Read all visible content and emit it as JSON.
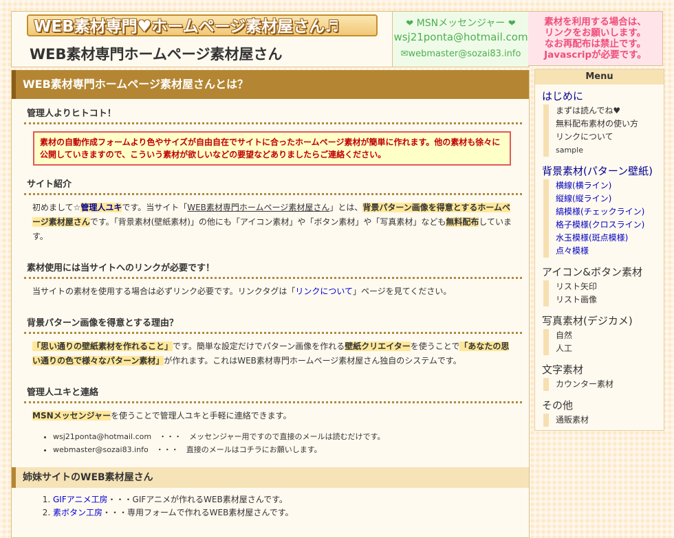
{
  "header": {
    "logo_text": "WEB素材専門♥ホームページ素材屋さん♬",
    "subtitle": "WEB素材専門ホームページ素材屋さん",
    "msn_title": "MSNメッセンジャー",
    "msn_email": "wsj21ponta@hotmail.com",
    "webmaster_email": "✉webmaster@sozai83.info"
  },
  "notice_box": {
    "lines": [
      "素材を利用する場合は、",
      "リンクをお願いします。",
      "なお再配布は禁止です。",
      "Javascripが必要です。"
    ]
  },
  "main": {
    "title": "WEB素材専門ホームページ素材屋さんとは？",
    "sections": {
      "hitokoto_title": "管理人よりヒトコト！",
      "hitokoto_text": "素材の自動作成フォームより色やサイズが自由自在でサイトに合ったホームページ素材が簡単に作れます。他の素材も徐々に公開していきますので、こういう素材が欲しいなどの要望などありましたらご連絡ください。",
      "intro_title": "サイト紹介",
      "intro_p1": "初めまして☆",
      "intro_name": "管理人ユキ",
      "intro_p2": "です。当サイト「",
      "intro_site": "WEB素材専門ホームページ素材屋さん",
      "intro_p3": "」とは、",
      "intro_hl1": "背景パターン画像を得意とするホームページ素材屋さん",
      "intro_p4": "です。「背景素材(壁紙素材)」の他にも「アイコン素材」や「ボタン素材」や「写真素材」なども",
      "intro_hl2": "無料配布",
      "intro_p5": "しています。",
      "link_title": "素材使用には当サイトへのリンクが必要です！",
      "link_p1": "当サイトの素材を使用する場合は必ずリンク必要です。リンクタグは「",
      "link_anchor": "リンクについて",
      "link_p2": "」ページを見てください。",
      "reason_title": "背景パターン画像を得意とする理由？",
      "reason_hl1": "「思い通りの壁紙素材を作れること」",
      "reason_p1": "です。簡単な設定だけでパターン画像を作れる",
      "reason_hl2": "壁紙クリエイター",
      "reason_p2": "を使うことで",
      "reason_hl3": "「あなたの思い通りの色で様々なパターン素材」",
      "reason_p3": "が作れます。これはWEB素材専門ホームページ素材屋さん独自のシステムです。",
      "contact_title": "管理人ユキと連絡",
      "contact_hl": "MSNメッセンジャー",
      "contact_p": "を使うことで管理人ユキと手軽に連絡できます。",
      "contacts": [
        {
          "email": "wsj21ponta@hotmail.com",
          "note": "・・・　メッセンジャー用ですので直接のメールは読むだけです。"
        },
        {
          "email": "webmaster@sozai83.info",
          "note": "・・・　直接のメールはコチラにお願いします。"
        }
      ]
    },
    "sister_title": "姉妹サイトのWEB素材屋さん",
    "sisters": [
      {
        "name": "GIFアニメ工房",
        "desc": "・・・GIFアニメが作れるWEB素材屋さんです。"
      },
      {
        "name": "素ボタン工房",
        "desc": "・・・専用フォームで作れるWEB素材屋さんです。"
      }
    ]
  },
  "sidebar": {
    "menu_title": "Menu",
    "categories": [
      {
        "label": "はじめに",
        "items": [
          "まずは読んでね♥",
          "無料配布素材の使い方",
          "リンクについて",
          "sample"
        ]
      },
      {
        "label": "背景素材(パターン壁紙)",
        "items": [
          "横線(横ライン)",
          "縦線(縦ライン)",
          "縞模様(チェックライン)",
          "格子模様(クロスライン)",
          "水玉模様(斑点模様)",
          "点々模様"
        ]
      },
      {
        "label": "アイコン&ボタン素材",
        "items": [
          "リスト矢印",
          "リスト画像"
        ]
      },
      {
        "label": "写真素材(デジカメ)",
        "items": [
          "自然",
          "人工"
        ]
      },
      {
        "label": "文字素材",
        "items": [
          "カウンター素材"
        ]
      },
      {
        "label": "その他",
        "items": [
          "通販素材"
        ]
      }
    ]
  }
}
